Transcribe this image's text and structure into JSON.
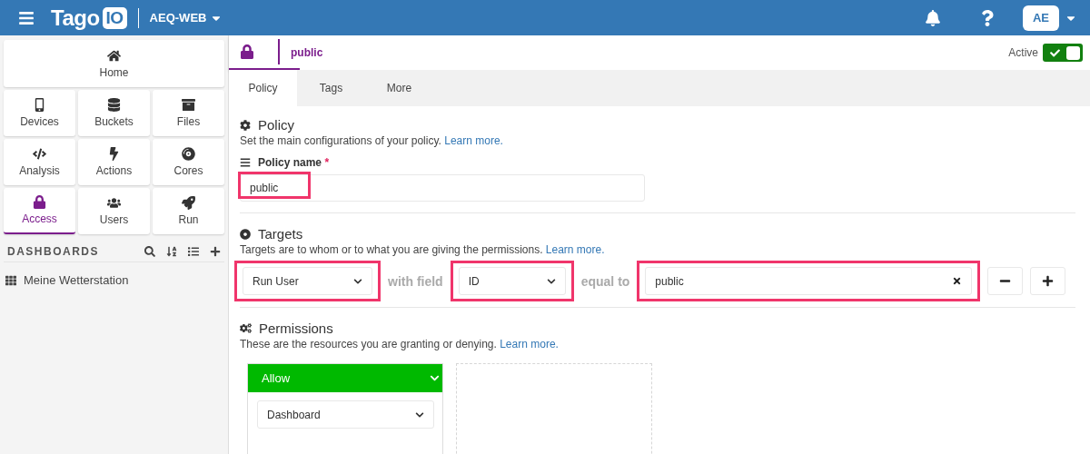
{
  "header": {
    "logo_text": "Tago",
    "logo_badge": "IO",
    "workspace": "AEQ-WEB",
    "avatar": "AE"
  },
  "sidebar": {
    "tiles": [
      {
        "label": "Home",
        "selected": false
      },
      {
        "label": "Devices",
        "selected": false
      },
      {
        "label": "Buckets",
        "selected": false
      },
      {
        "label": "Files",
        "selected": false
      },
      {
        "label": "Analysis",
        "selected": false
      },
      {
        "label": "Actions",
        "selected": false
      },
      {
        "label": "Cores",
        "selected": false
      },
      {
        "label": "Access",
        "selected": true
      },
      {
        "label": "Users",
        "selected": false
      },
      {
        "label": "Run",
        "selected": false
      }
    ],
    "dashboards": {
      "title": "DASHBOARDS",
      "items": [
        "Meine Wetterstation"
      ]
    }
  },
  "policy_bar": {
    "name": "public",
    "active_label": "Active",
    "active": true
  },
  "tabs": [
    {
      "label": "Policy",
      "selected": true
    },
    {
      "label": "Tags",
      "selected": false
    },
    {
      "label": "More",
      "selected": false
    }
  ],
  "policy": {
    "title": "Policy",
    "description": "Set the main configurations of your policy.",
    "link": "Learn more.",
    "field_label": "Policy name",
    "required_mark": "*",
    "value": "public",
    "highlighted": true
  },
  "targets": {
    "title": "Targets",
    "description": "Targets are to whom or to what you are giving the permissions.",
    "link": "Learn more.",
    "target_type": {
      "value": "Run User",
      "highlighted": true
    },
    "connector_1": "with field",
    "field": {
      "value": "ID",
      "highlighted": true
    },
    "connector_2": "equal to",
    "target_value": {
      "value": "public",
      "highlighted": true
    }
  },
  "permissions": {
    "title": "Permissions",
    "description": "These are the resources you are granting or denying.",
    "link": "Learn more.",
    "effect": "Allow",
    "resource": "Dashboard"
  }
}
